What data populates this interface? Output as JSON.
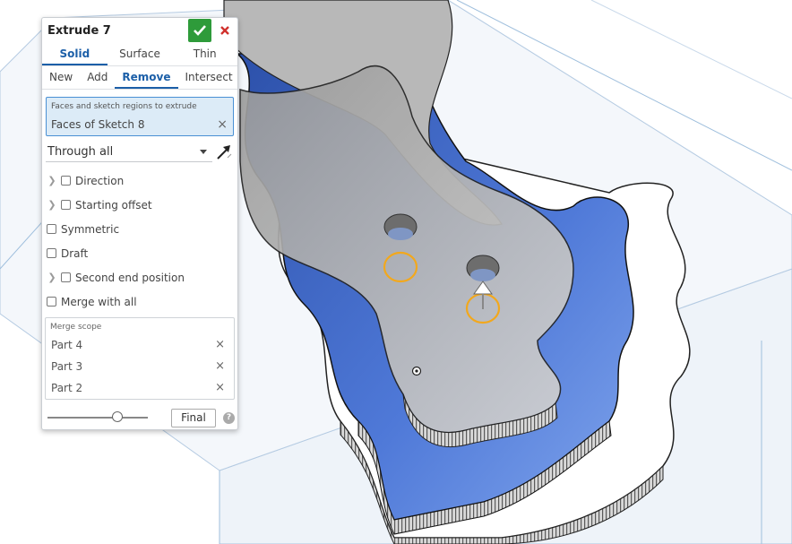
{
  "dialog": {
    "title": "Extrude 7",
    "type_tabs": [
      "Solid",
      "Surface",
      "Thin"
    ],
    "operation_tabs": [
      "New",
      "Add",
      "Remove",
      "Intersect"
    ],
    "active_type": "Solid",
    "active_operation": "Remove",
    "faces_field": {
      "label": "Faces and sketch regions to extrude",
      "value": "Faces of Sketch 8"
    },
    "end_type": "Through all",
    "options": {
      "direction": "Direction",
      "starting_offset": "Starting offset",
      "symmetric": "Symmetric",
      "draft": "Draft",
      "second_end_position": "Second end position",
      "merge_with_all": "Merge with all"
    },
    "merge_scope": {
      "label": "Merge scope",
      "items": [
        "Part 4",
        "Part 3",
        "Part 2"
      ]
    },
    "preview_slider_value": 0.7,
    "final_label": "Final",
    "help_glyph": "?"
  },
  "colors": {
    "accent": "#1c5fa8",
    "ok_green": "#2e9b3a",
    "cancel_red": "#d0312d",
    "selection_blue_fill": "#dcebf7",
    "part_blue": "#3a63c8",
    "highlight_orange": "#f2a81d"
  },
  "icons": {
    "ok": "checkmark-icon",
    "cancel": "close-icon",
    "flip": "flip-direction-arrow-icon",
    "expand": "chevron-right-icon",
    "help": "help-icon"
  }
}
